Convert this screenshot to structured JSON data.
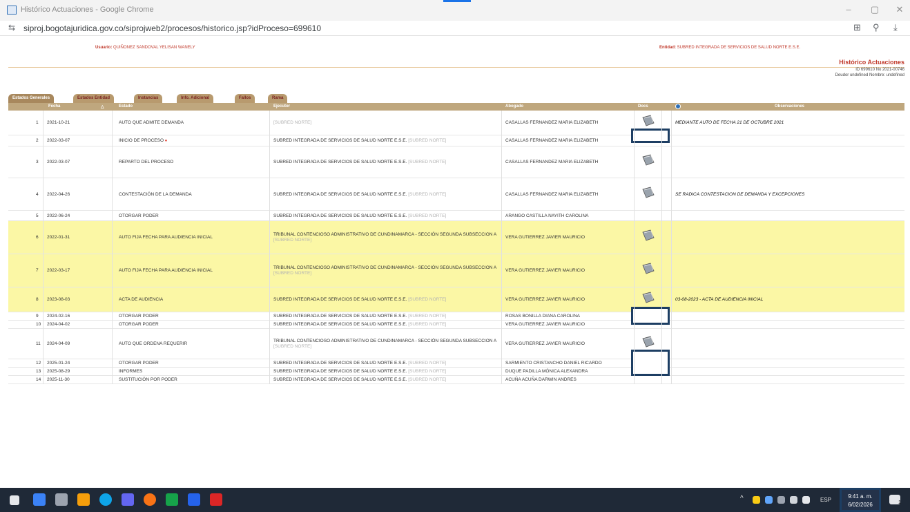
{
  "browser": {
    "window_title": "Histórico Actuaciones - Google Chrome",
    "url": "siproj.bogotajuridica.gov.co/siprojweb2/procesos/historico.jsp?idProceso=699610",
    "minimize_label": "–",
    "restore_label": "▢",
    "close_label": "✕"
  },
  "header": {
    "user_label": "Usuario:",
    "user_value": "QUIÑONEZ SANDOVAL YELISAN WANELY",
    "entity_label": "Entidad:",
    "entity_value": "SUBRED INTEGRADA DE SERVICIOS DE SALUD NORTE E.S.E.",
    "title": "Histórico Actuaciones",
    "sub1": "ID 699610  No 2021-00746",
    "sub2": "Deudor undefined Nombre: undefined"
  },
  "tabs": [
    {
      "label": "Estados Generales"
    },
    {
      "label": "Estados Entidad"
    },
    {
      "label": "Instancias"
    },
    {
      "label": "Info. Adicional"
    },
    {
      "label": "Fallos"
    },
    {
      "label": "Rama"
    }
  ],
  "columns": {
    "fecha": "Fecha",
    "estado": "Estado",
    "ejecutor": "Ejecutor",
    "abogado": "Abogado",
    "docs": "Docs",
    "observaciones": "Observaciones"
  },
  "rows": [
    {
      "n": "1",
      "fecha": "2021-10-21",
      "estado": "AUTO QUE ADMITE DEMANDA",
      "ejecutor": "",
      "ejecutor_muted": "[SUBRED NORTE]",
      "abogado": "CASALLAS FERNANDEZ MARIA ELIZABETH",
      "obs": "MEDIANTE AUTO DE FECHA 21 DE OCTUBRE 2021"
    },
    {
      "n": "2",
      "fecha": "2022-03-07",
      "estado": "INICIO DE PROCESO",
      "ejecutor": "SUBRED INTEGRADA DE SERVICIOS DE SALUD NORTE E.S.E.",
      "ejecutor_muted": "[SUBRED NORTE]",
      "abogado": "CASALLAS FERNANDEZ MARIA ELIZABETH",
      "obs": ""
    },
    {
      "n": "3",
      "fecha": "2022-03-07",
      "estado": "REPARTO DEL PROCESO",
      "ejecutor": "SUBRED INTEGRADA DE SERVICIOS DE SALUD NORTE E.S.E.",
      "ejecutor_muted": "[SUBRED NORTE]",
      "abogado": "CASALLAS FERNANDEZ MARIA ELIZABETH",
      "obs": ""
    },
    {
      "n": "4",
      "fecha": "2022-04-26",
      "estado": "CONTESTACIÓN DE LA DEMANDA",
      "ejecutor": "SUBRED INTEGRADA DE SERVICIOS DE SALUD NORTE E.S.E.",
      "ejecutor_muted": "[SUBRED NORTE]",
      "abogado": "CASALLAS FERNANDEZ MARIA ELIZABETH",
      "obs": "SE RADICA CONTESTACION DE DEMANDA Y EXCEPCIONES"
    },
    {
      "n": "5",
      "fecha": "2022-06-24",
      "estado": "OTORGAR PODER",
      "ejecutor": "SUBRED INTEGRADA DE SERVICIOS DE SALUD NORTE E.S.E.",
      "ejecutor_muted": "[SUBRED NORTE]",
      "abogado": "ARANGO CASTILLA NAYITH CAROLINA",
      "obs": ""
    },
    {
      "n": "6",
      "fecha": "2022-01-31",
      "estado": "AUTO FIJA FECHA PARA AUDIENCIA INICIAL",
      "ejecutor": "TRIBUNAL CONTENCIOSO ADMINISTRATIVO DE CUNDINAMARCA - SECCIÓN SEGUNDA SUBSECCION A",
      "ejecutor_muted": "[SUBRED NORTE]",
      "abogado": "VERA GUTIERREZ JAVIER MAURICIO",
      "obs": ""
    },
    {
      "n": "7",
      "fecha": "2022-03-17",
      "estado": "AUTO FIJA FECHA PARA AUDIENCIA INICIAL",
      "ejecutor": "TRIBUNAL CONTENCIOSO ADMINISTRATIVO DE CUNDINAMARCA - SECCIÓN SEGUNDA SUBSECCION A",
      "ejecutor_muted": "[SUBRED NORTE]",
      "abogado": "VERA GUTIERREZ JAVIER MAURICIO",
      "obs": ""
    },
    {
      "n": "8",
      "fecha": "2023-08-03",
      "estado": "ACTA DE AUDIENCIA",
      "ejecutor": "SUBRED INTEGRADA DE SERVICIOS DE SALUD NORTE E.S.E.",
      "ejecutor_muted": "[SUBRED NORTE]",
      "abogado": "VERA GUTIERREZ JAVIER MAURICIO",
      "obs": "03-08-2023 - ACTA DE AUDIENCIA INICIAL"
    },
    {
      "n": "9",
      "fecha": "2024-02-16",
      "estado": "OTORGAR PODER",
      "ejecutor": "SUBRED INTEGRADA DE SERVICIOS DE SALUD NORTE E.S.E.",
      "ejecutor_muted": "[SUBRED NORTE]",
      "abogado": "ROSAS BONILLA DIANA CAROLINA",
      "obs": ""
    },
    {
      "n": "10",
      "fecha": "2024-04-02",
      "estado": "OTORGAR PODER",
      "ejecutor": "SUBRED INTEGRADA DE SERVICIOS DE SALUD NORTE E.S.E.",
      "ejecutor_muted": "[SUBRED NORTE]",
      "abogado": "VERA GUTIERREZ JAVIER MAURICIO",
      "obs": ""
    },
    {
      "n": "11",
      "fecha": "2024-04-09",
      "estado": "AUTO QUE ORDENA REQUERIR",
      "ejecutor": "TRIBUNAL CONTENCIOSO ADMINISTRATIVO DE CUNDINAMARCA - SECCIÓN SEGUNDA SUBSECCION A",
      "ejecutor_muted": "[SUBRED NORTE]",
      "abogado": "VERA GUTIERREZ JAVIER MAURICIO",
      "obs": ""
    },
    {
      "n": "12",
      "fecha": "2025-01-24",
      "estado": "OTORGAR PODER",
      "ejecutor": "SUBRED INTEGRADA DE SERVICIOS DE SALUD NORTE E.S.E.",
      "ejecutor_muted": "[SUBRED NORTE]",
      "abogado": "SARMIENTO CRISTANCHO DANIEL RICARDO",
      "obs": ""
    },
    {
      "n": "13",
      "fecha": "2025-08-29",
      "estado": "INFORMES",
      "ejecutor": "SUBRED INTEGRADA DE SERVICIOS DE SALUD NORTE E.S.E.",
      "ejecutor_muted": "[SUBRED NORTE]",
      "abogado": "DUQUE PADILLA MÓNICA ALEXANDRA",
      "obs": ""
    },
    {
      "n": "14",
      "fecha": "2025-11-30",
      "estado": "SUSTITUCIÓN POR PODER",
      "ejecutor": "SUBRED INTEGRADA DE SERVICIOS DE SALUD NORTE E.S.E.",
      "ejecutor_muted": "[SUBRED NORTE]",
      "abogado": "ACUÑA ACUÑA DARWIN ANDRES",
      "obs": ""
    }
  ],
  "taskbar": {
    "lang": "ESP",
    "time": "9:41 a. m.",
    "date": "6/02/2026",
    "tray_arrow": "^",
    "notif_count": "1"
  },
  "colors": {
    "accent_red": "#c0392b",
    "tab_bg": "#b89a6e",
    "header_bg": "#bfa77e",
    "highlight_row": "#fbf7a5",
    "taskbar": "#1f2937"
  }
}
